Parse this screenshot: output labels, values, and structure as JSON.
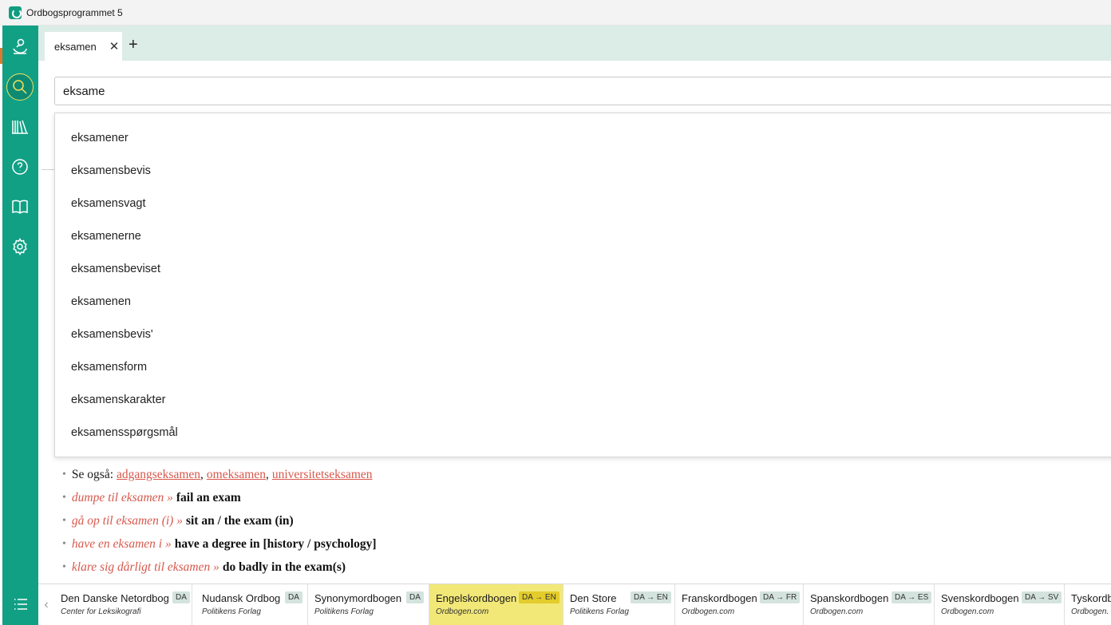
{
  "window": {
    "title": "Ordbogsprogrammet 5"
  },
  "rail": {
    "items": [
      {
        "icon": "profile-icon"
      },
      {
        "icon": "search-icon",
        "active": true
      },
      {
        "icon": "library-icon"
      },
      {
        "icon": "help-icon"
      },
      {
        "icon": "book-icon"
      },
      {
        "icon": "gear-icon"
      }
    ],
    "menu_icon": "list-menu-icon"
  },
  "tabs": [
    {
      "label": "eksamen",
      "close": "✕"
    }
  ],
  "tab_add": "+",
  "search": {
    "value": "eksame"
  },
  "suggestions": [
    "eksamener",
    "eksamensbevis",
    "eksamensvagt",
    "eksamenerne",
    "eksamensbeviset",
    "eksamenen",
    "eksamensbevis'",
    "eksamensform",
    "eksamenskarakter",
    "eksamensspørgsmål"
  ],
  "entries": {
    "see_also": {
      "label": "Se også:",
      "links": [
        "adgangseksamen",
        "omeksamen",
        "universitetseksamen"
      ],
      "separator": ","
    },
    "phrases": [
      {
        "phrase": "dumpe til eksamen »",
        "gloss": "fail an exam"
      },
      {
        "phrase": "gå op til eksamen (i) »",
        "gloss": "sit an / the exam (in)"
      },
      {
        "phrase": "have en eksamen i »",
        "gloss": "have a degree in [history / psychology]"
      },
      {
        "phrase": "klare sig dårligt til eksamen »",
        "gloss": "do badly in the exam(s)"
      }
    ]
  },
  "dictionaries": [
    {
      "name": "Den Danske Netordbog",
      "publisher": "Center for Leksikografi",
      "badge": "DA"
    },
    {
      "name": "Nudansk Ordbog",
      "publisher": "Politikens Forlag",
      "badge": "DA"
    },
    {
      "name": "Synonymordbogen",
      "publisher": "Politikens Forlag",
      "badge": "DA"
    },
    {
      "name": "Engelskordbogen",
      "publisher": "Ordbogen.com",
      "badge": "DA → EN",
      "active": true
    },
    {
      "name": "Den Store",
      "publisher": "Politikens Forlag",
      "badge": "DA → EN"
    },
    {
      "name": "Franskordbogen",
      "publisher": "Ordbogen.com",
      "badge": "DA → FR"
    },
    {
      "name": "Spanskordbogen",
      "publisher": "Ordbogen.com",
      "badge": "DA → ES"
    },
    {
      "name": "Svenskordbogen",
      "publisher": "Ordbogen.com",
      "badge": "DA → SV"
    },
    {
      "name": "Tyskordb",
      "publisher": "Ordbogen.",
      "badge": ""
    }
  ],
  "scroll_left": "‹",
  "colors": {
    "rail": "#12a085",
    "active_dict": "#f2e878",
    "link": "#d7584c",
    "tabbar": "#dcece7"
  }
}
